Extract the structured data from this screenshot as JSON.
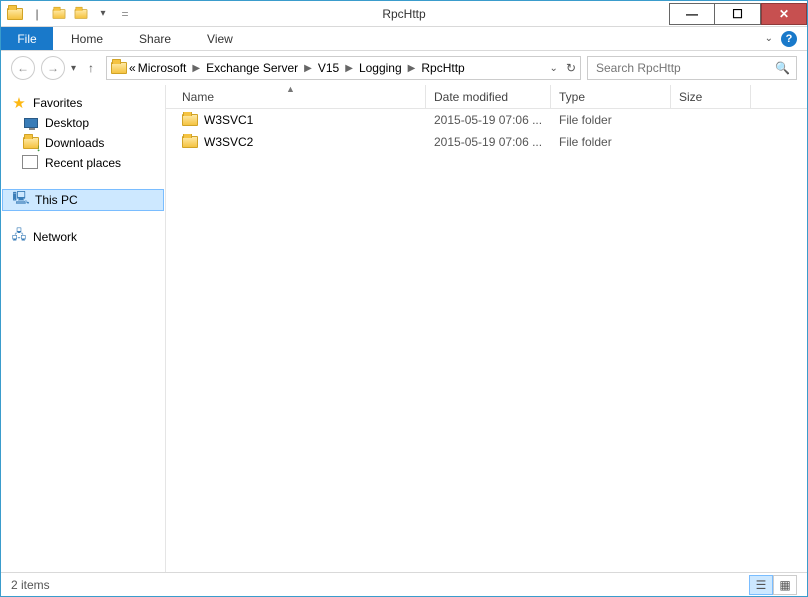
{
  "window": {
    "title": "RpcHttp"
  },
  "ribbon": {
    "file": "File",
    "tabs": [
      "Home",
      "Share",
      "View"
    ]
  },
  "nav": {
    "breadcrumb_prefix": "«",
    "crumbs": [
      "Microsoft",
      "Exchange Server",
      "V15",
      "Logging",
      "RpcHttp"
    ]
  },
  "search": {
    "placeholder": "Search RpcHttp"
  },
  "sidebar": {
    "favorites": {
      "label": "Favorites",
      "items": [
        {
          "label": "Desktop"
        },
        {
          "label": "Downloads"
        },
        {
          "label": "Recent places"
        }
      ]
    },
    "thispc": {
      "label": "This PC"
    },
    "network": {
      "label": "Network"
    }
  },
  "columns": {
    "name": "Name",
    "date": "Date modified",
    "type": "Type",
    "size": "Size"
  },
  "files": [
    {
      "name": "W3SVC1",
      "date": "2015-05-19 07:06 ...",
      "type": "File folder",
      "size": ""
    },
    {
      "name": "W3SVC2",
      "date": "2015-05-19 07:06 ...",
      "type": "File folder",
      "size": ""
    }
  ],
  "status": {
    "text": "2 items"
  }
}
